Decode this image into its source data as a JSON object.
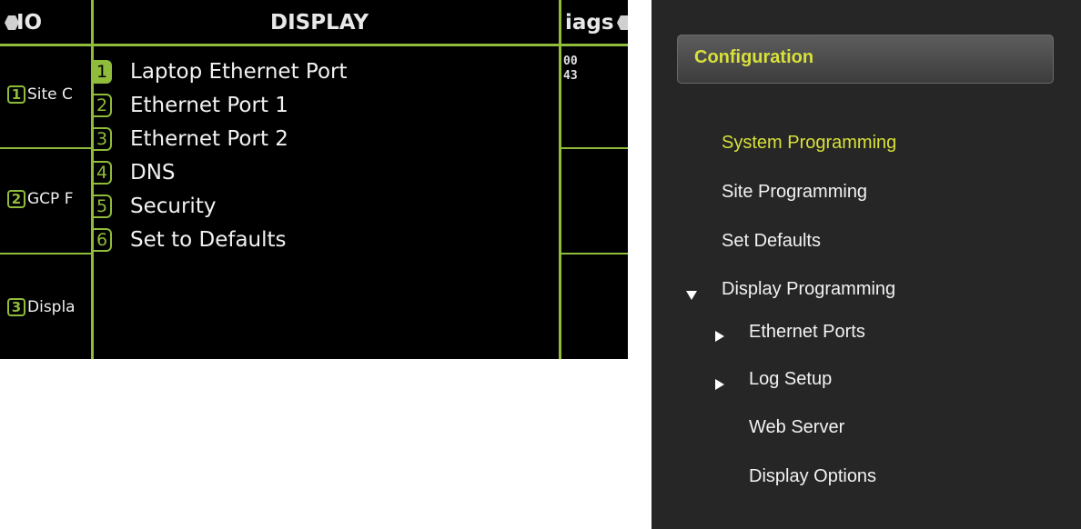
{
  "screen": {
    "left_header": "IO",
    "title": "DISPLAY",
    "right_header": "iags",
    "side_buttons": [
      {
        "num": "1",
        "label": "Site C"
      },
      {
        "num": "2",
        "label": "GCP F"
      },
      {
        "num": "3",
        "label": "Displa"
      }
    ],
    "menu": [
      {
        "num": "1",
        "label": "Laptop Ethernet Port"
      },
      {
        "num": "2",
        "label": "Ethernet Port 1"
      },
      {
        "num": "3",
        "label": "Ethernet Port 2"
      },
      {
        "num": "4",
        "label": "DNS"
      },
      {
        "num": "5",
        "label": "Security"
      },
      {
        "num": "6",
        "label": "Set to Defaults"
      }
    ],
    "diag_values": [
      "00",
      "43"
    ]
  },
  "config": {
    "title": "Configuration",
    "items": [
      {
        "label": "System Programming"
      },
      {
        "label": "Site Programming"
      },
      {
        "label": "Set Defaults"
      },
      {
        "label": "Display Programming"
      },
      {
        "label": "Ethernet Ports"
      },
      {
        "label": "Log Setup"
      },
      {
        "label": "Web Server"
      },
      {
        "label": "Display Options"
      }
    ]
  },
  "colors": {
    "accent_green": "#8fbc3a",
    "active_yellow": "#d8e03a",
    "panel_bg": "#262626"
  },
  "icons": {
    "screen_header_left": "hexagon-icon",
    "screen_header_right": "hexagon-icon",
    "tree_expanded": "triangle-down-icon",
    "tree_collapsed": "triangle-right-icon"
  }
}
